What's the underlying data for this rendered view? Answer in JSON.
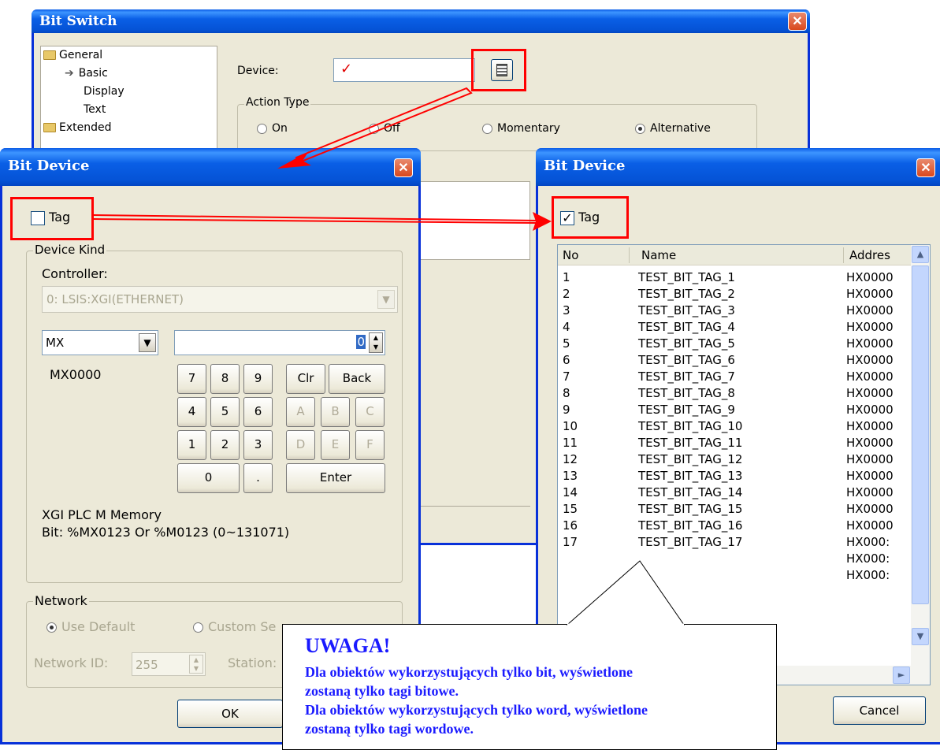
{
  "bit_switch": {
    "title": "Bit Switch",
    "close_icon": "close-icon",
    "tree": [
      {
        "label": "General",
        "icon": "folder-icon"
      },
      {
        "label": "Basic",
        "icon": "arrow-right-icon"
      },
      {
        "label": "Display",
        "icon": ""
      },
      {
        "label": "Text",
        "icon": ""
      },
      {
        "label": "Extended",
        "icon": "folder-icon"
      }
    ],
    "device_label": "Device:",
    "device_value": "",
    "device_validity_icon": "checkmark-icon",
    "device_picker_icon": "calculator-icon",
    "action_type_label": "Action Type",
    "action_types": [
      "On",
      "Off",
      "Momentary",
      "Alternative"
    ],
    "action_type_selected": "Alternative"
  },
  "bit_device_left": {
    "title": "Bit Device",
    "tag_label": "Tag",
    "tag_checked": false,
    "device_kind_label": "Device Kind",
    "controller_label": "Controller:",
    "controller_value": "0: LSIS:XGI(ETHERNET)",
    "device_type_value": "MX",
    "address_value": "0",
    "address_preview": "MX0000",
    "keypad": [
      [
        "7",
        "8",
        "9",
        "Clr",
        "Back"
      ],
      [
        "4",
        "5",
        "6",
        "A",
        "B",
        "C"
      ],
      [
        "1",
        "2",
        "3",
        "D",
        "E",
        "F"
      ],
      [
        "0",
        ".",
        "Enter"
      ]
    ],
    "help_line1": "XGI PLC M Memory",
    "help_line2": "Bit: %MX0123 Or %M0123 (0~131071)",
    "network_label": "Network",
    "use_default_label": "Use Default",
    "custom_label": "Custom Se",
    "network_id_label": "Network ID:",
    "network_id_value": "255",
    "station_label": "Station:",
    "ok_label": "OK"
  },
  "bit_device_right": {
    "title": "Bit Device",
    "tag_label": "Tag",
    "tag_checked": true,
    "columns": [
      "No",
      "Name",
      "Addres"
    ],
    "rows": [
      [
        "1",
        "TEST_BIT_TAG_1",
        "HX0000"
      ],
      [
        "2",
        "TEST_BIT_TAG_2",
        "HX0000"
      ],
      [
        "3",
        "TEST_BIT_TAG_3",
        "HX0000"
      ],
      [
        "4",
        "TEST_BIT_TAG_4",
        "HX0000"
      ],
      [
        "5",
        "TEST_BIT_TAG_5",
        "HX0000"
      ],
      [
        "6",
        "TEST_BIT_TAG_6",
        "HX0000"
      ],
      [
        "7",
        "TEST_BIT_TAG_7",
        "HX0000"
      ],
      [
        "8",
        "TEST_BIT_TAG_8",
        "HX0000"
      ],
      [
        "9",
        "TEST_BIT_TAG_9",
        "HX0000"
      ],
      [
        "10",
        "TEST_BIT_TAG_10",
        "HX0000"
      ],
      [
        "11",
        "TEST_BIT_TAG_11",
        "HX0000"
      ],
      [
        "12",
        "TEST_BIT_TAG_12",
        "HX0000"
      ],
      [
        "13",
        "TEST_BIT_TAG_13",
        "HX0000"
      ],
      [
        "14",
        "TEST_BIT_TAG_14",
        "HX0000"
      ],
      [
        "15",
        "TEST_BIT_TAG_15",
        "HX0000"
      ],
      [
        "16",
        "TEST_BIT_TAG_16",
        "HX0000"
      ],
      [
        "17",
        "TEST_BIT_TAG_17",
        "HX000:"
      ],
      [
        "",
        "",
        "HX000:"
      ],
      [
        "",
        "",
        "HX000:"
      ]
    ],
    "cancel_label": "Cancel"
  },
  "note": {
    "heading": "UWAGA!",
    "line1": "Dla obiektów wykorzystujących tylko bit, wyświetlone",
    "line2": "zostaną tylko tagi bitowe.",
    "line3": "Dla obiektów wykorzystujących tylko word, wyświetlone",
    "line4": "zostaną tylko tagi wordowe."
  },
  "colors": {
    "titlebar": "#0553d6",
    "window_bg": "#ece9d8",
    "highlight": "#ff0000",
    "note_text": "#1a1aff"
  }
}
